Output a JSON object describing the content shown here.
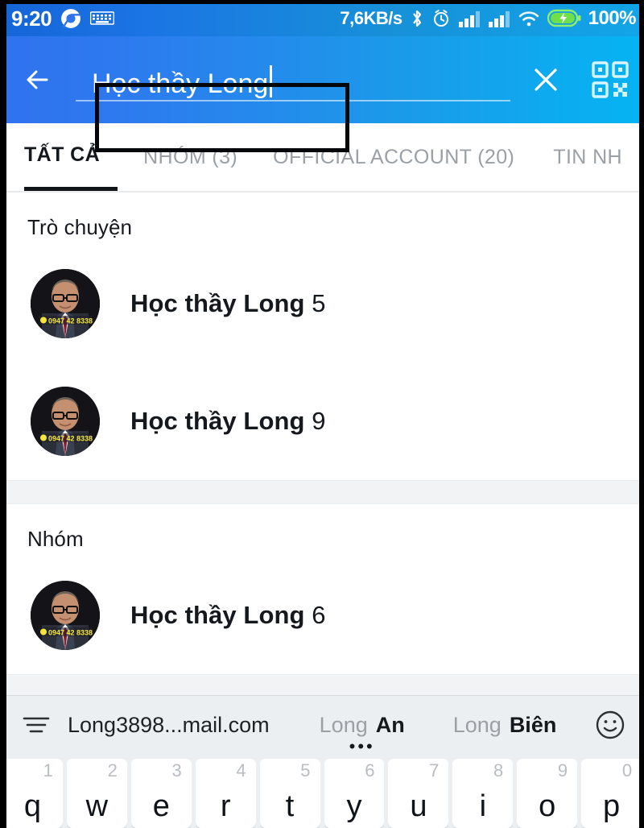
{
  "statusbar": {
    "time": "9:20",
    "icons_left": [
      "chrome-icon",
      "keyboard-icon"
    ],
    "net_speed": "7,6KB/s",
    "icons_right": [
      "bluetooth-icon",
      "alarm-icon",
      "signal-1-icon",
      "signal-2-icon",
      "wifi-icon",
      "battery-charging-icon"
    ],
    "battery_percent": "100%"
  },
  "header": {
    "back_icon": "back-arrow-icon",
    "search_value": "Học thầy Long",
    "clear_icon": "close-icon",
    "qr_icon": "qr-code-icon"
  },
  "tabs": [
    {
      "label": "TẤT CẢ",
      "active": true
    },
    {
      "label": "NHÓM (3)",
      "active": false
    },
    {
      "label": "OFFICIAL ACCOUNT (20)",
      "active": false
    },
    {
      "label": "TIN NH",
      "active": false
    }
  ],
  "sections": [
    {
      "title": "Trò chuyện",
      "items": [
        {
          "name": "Học thầy Long",
          "suffix": "5",
          "avatar_badge": "0947 42 8338"
        },
        {
          "name": "Học thầy Long",
          "suffix": "9",
          "avatar_badge": "0947 42 8338"
        }
      ]
    },
    {
      "title": "Nhóm",
      "items": [
        {
          "name": "Học thầy Long",
          "suffix": "6",
          "avatar_badge": "0947 42 8338"
        }
      ]
    }
  ],
  "keyboard": {
    "menu_icon": "keyboard-menu-icon",
    "suggestions": [
      {
        "text": "Long3898...mail.com",
        "dim": "",
        "strong": ""
      },
      {
        "dim": "Long",
        "strong": "An",
        "dots": "•••"
      },
      {
        "dim": "Long",
        "strong": "Biên"
      }
    ],
    "emoji_icon": "smiley-icon",
    "row1": [
      {
        "letter": "q",
        "num": "1"
      },
      {
        "letter": "w",
        "num": "2"
      },
      {
        "letter": "e",
        "num": "3"
      },
      {
        "letter": "r",
        "num": "4"
      },
      {
        "letter": "t",
        "num": "5"
      },
      {
        "letter": "y",
        "num": "6"
      },
      {
        "letter": "u",
        "num": "7"
      },
      {
        "letter": "i",
        "num": "8"
      },
      {
        "letter": "o",
        "num": "9"
      },
      {
        "letter": "p",
        "num": "0"
      }
    ]
  },
  "colors": {
    "header_start": "#2f73ee",
    "header_end": "#05b4f3",
    "tab_active": "#14181c",
    "tab_inactive": "#9aa0a6",
    "annotation_box": "#05060a"
  }
}
